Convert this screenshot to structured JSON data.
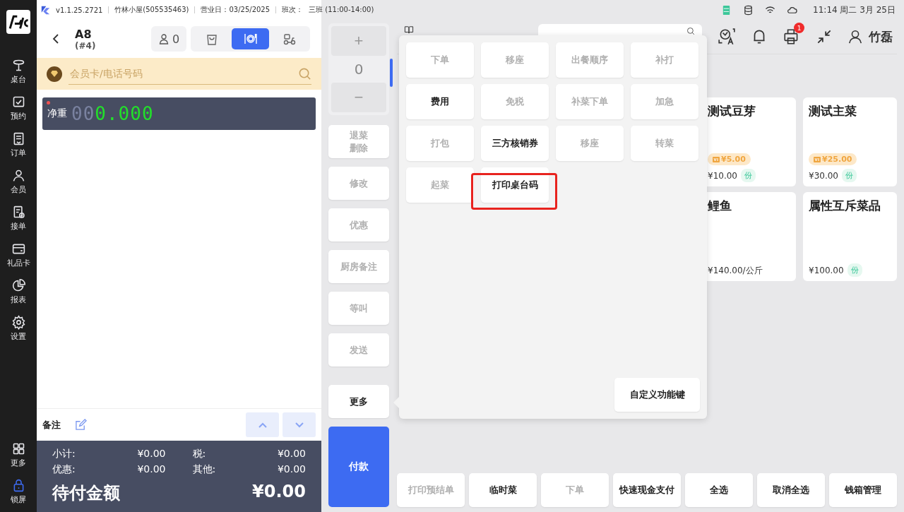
{
  "status_bar": {
    "version": "v1.1.25.2721",
    "store": "竹林小屋(505535463)",
    "business_day": "营业日：03/25/2025",
    "shift_label": "班次：",
    "shift": "三班 (11:00-14:00)",
    "clock": "11:14 周二 3月 25日"
  },
  "nav": {
    "items": [
      {
        "label": "桌台"
      },
      {
        "label": "预约"
      },
      {
        "label": "订单"
      },
      {
        "label": "会员"
      },
      {
        "label": "接单"
      },
      {
        "label": "礼品卡"
      },
      {
        "label": "报表"
      },
      {
        "label": "设置"
      }
    ],
    "bottom": [
      {
        "label": "更多",
        "selected": false
      },
      {
        "label": "锁屏",
        "selected": true
      }
    ]
  },
  "order": {
    "table": "A8",
    "number": "(#4)",
    "guests": "0",
    "types": [
      {
        "selected": false
      },
      {
        "selected": true
      },
      {
        "selected": false
      }
    ],
    "member_search": {
      "placeholder": "会员卡/电话号码"
    },
    "scale": {
      "label": "净重",
      "dim_digits": "00",
      "reading": "0.000"
    },
    "remark": "备注",
    "summary": [
      {
        "label": "小计:",
        "value": "¥0.00"
      },
      {
        "label": "税:",
        "value": "¥0.00"
      },
      {
        "label": "优惠:",
        "value": "¥0.00"
      },
      {
        "label": "其他:",
        "value": "¥0.00"
      }
    ],
    "total": {
      "label": "待付金额",
      "value": "¥0.00"
    }
  },
  "quantity": {
    "plus": "+",
    "value": "0",
    "minus": "−"
  },
  "actions": [
    {
      "lines": [
        "退菜",
        "删除"
      ],
      "disabled": true
    },
    {
      "lines": [
        "修改"
      ],
      "disabled": true
    },
    {
      "lines": [
        "优惠"
      ],
      "disabled": true
    },
    {
      "lines": [
        "厨房备注"
      ],
      "disabled": true
    },
    {
      "lines": [
        "等叫"
      ],
      "disabled": true
    },
    {
      "lines": [
        "发送"
      ],
      "disabled": true
    }
  ],
  "more_button": "更多",
  "pay_button": "付款",
  "header": {
    "user": "竹磊",
    "notification_count": "1"
  },
  "dishes": [
    {
      "name": "测试豆芽",
      "member_price": "¥5.00",
      "price": "¥10.00",
      "unit": "份"
    },
    {
      "name": "测试主菜",
      "member_price": "¥25.00",
      "price": "¥30.00",
      "unit": "份"
    },
    {
      "name": "鲤鱼",
      "price": "¥140.00/公斤"
    },
    {
      "name": "属性互斥菜品",
      "price": "¥100.00",
      "unit": "份"
    }
  ],
  "bottom_buttons": [
    {
      "label": "打印预结单",
      "disabled": true
    },
    {
      "label": "临时菜",
      "disabled": false
    },
    {
      "label": "下单",
      "disabled": true
    },
    {
      "label": "快速现金支付",
      "disabled": false
    },
    {
      "label": "全选",
      "disabled": false
    },
    {
      "label": "取消全选",
      "disabled": false
    },
    {
      "label": "钱箱管理",
      "disabled": false
    }
  ],
  "more_popup": {
    "buttons": [
      {
        "label": "下单",
        "disabled": true,
        "highlighted": false
      },
      {
        "label": "移座",
        "disabled": true,
        "highlighted": false
      },
      {
        "label": "出餐顺序",
        "disabled": true,
        "highlighted": false
      },
      {
        "label": "补打",
        "disabled": true,
        "highlighted": false
      },
      {
        "label": "费用",
        "disabled": false,
        "highlighted": false
      },
      {
        "label": "免税",
        "disabled": true,
        "highlighted": false
      },
      {
        "label": "补菜下单",
        "disabled": true,
        "highlighted": false
      },
      {
        "label": "加急",
        "disabled": true,
        "highlighted": false
      },
      {
        "label": "打包",
        "disabled": true,
        "highlighted": false
      },
      {
        "label": "三方核销券",
        "disabled": false,
        "highlighted": false
      },
      {
        "label": "移座",
        "disabled": true,
        "highlighted": false
      },
      {
        "label": "转菜",
        "disabled": true,
        "highlighted": false
      },
      {
        "label": "起菜",
        "disabled": true,
        "highlighted": false
      },
      {
        "label": "打印桌台码",
        "disabled": false,
        "highlighted": true
      }
    ],
    "customize_button": "自定义功能键"
  }
}
